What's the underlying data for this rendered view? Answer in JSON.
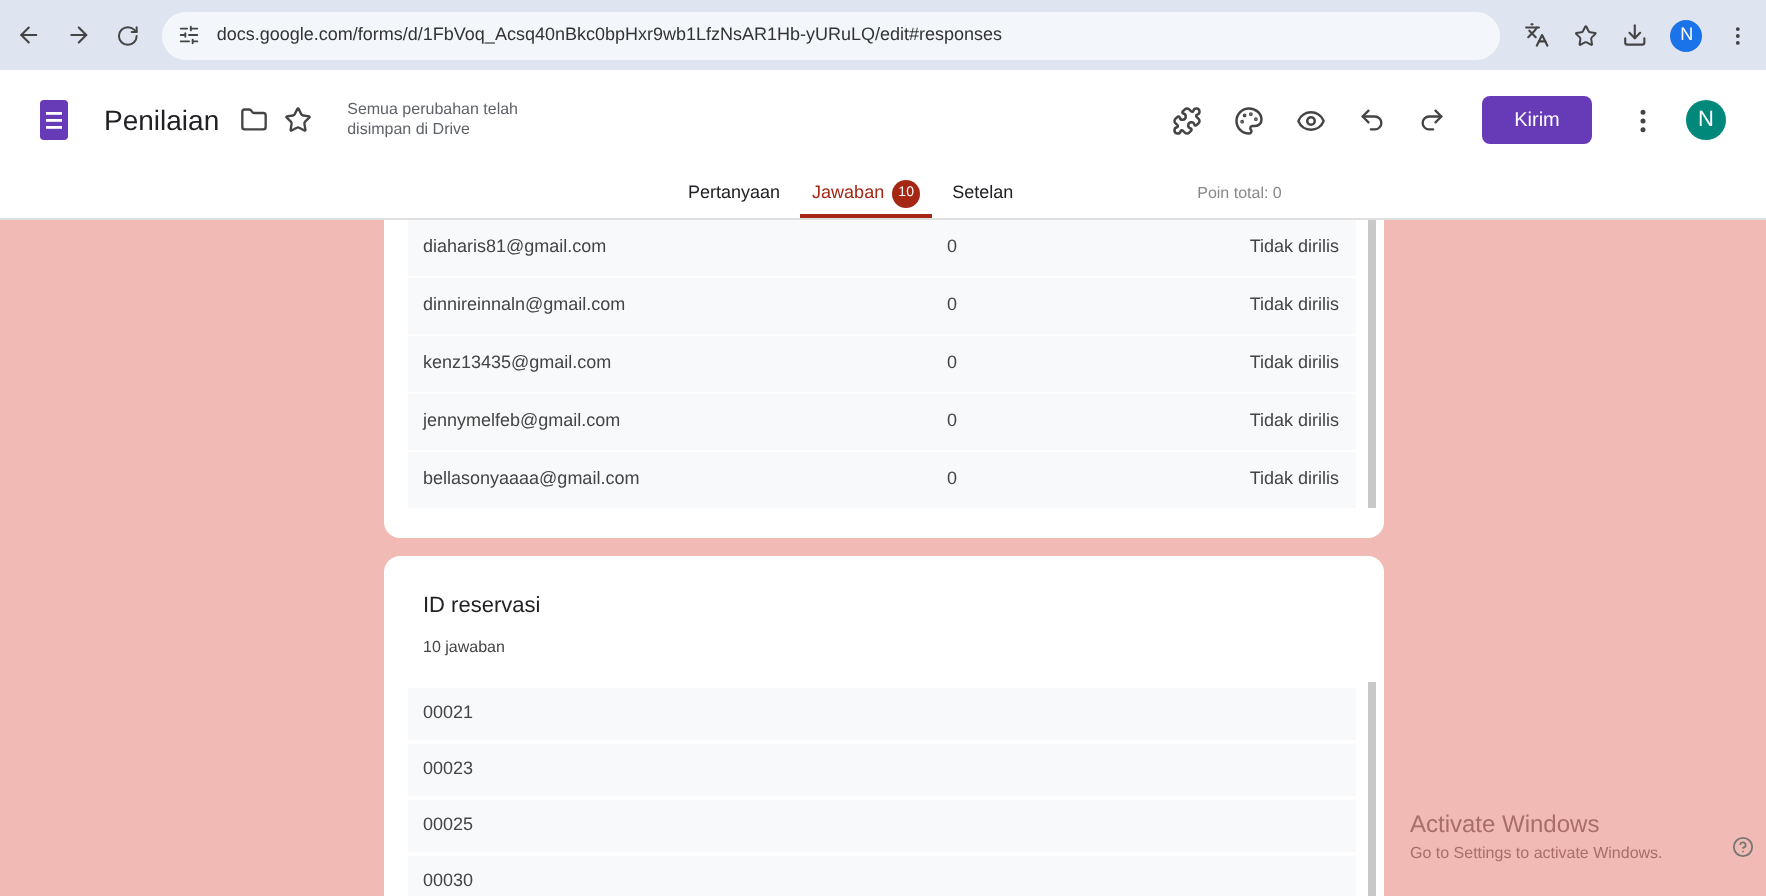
{
  "browser": {
    "url": "docs.google.com/forms/d/1FbVoq_Acsq40nBkc0bpHxr9wb1LfzNsAR1Hb-yURuLQ/edit#responses",
    "profile_initial": "N"
  },
  "app": {
    "title": "Penilaian",
    "save_status": "Semua perubahan telah disimpan di Drive",
    "send_button": "Kirim",
    "avatar_initial": "N"
  },
  "tabs": [
    {
      "label": "Pertanyaan",
      "selected": false
    },
    {
      "label": "Jawaban",
      "selected": true,
      "badge": "10"
    },
    {
      "label": "Setelan",
      "selected": false
    }
  ],
  "points_total": "Poin total: 0",
  "score_rows": [
    {
      "email": "diaharis81@gmail.com",
      "score": "0",
      "status": "Tidak dirilis"
    },
    {
      "email": "dinnireinnaln@gmail.com",
      "score": "0",
      "status": "Tidak dirilis"
    },
    {
      "email": "kenz13435@gmail.com",
      "score": "0",
      "status": "Tidak dirilis"
    },
    {
      "email": "jennymelfeb@gmail.com",
      "score": "0",
      "status": "Tidak dirilis"
    },
    {
      "email": "bellasonyaaaa@gmail.com",
      "score": "0",
      "status": "Tidak dirilis"
    }
  ],
  "question": {
    "title": "ID reservasi",
    "count": "10 jawaban",
    "answers": [
      "00021",
      "00023",
      "00025",
      "00030"
    ]
  },
  "activation": {
    "title": "Activate Windows",
    "subtitle": "Go to Settings to activate Windows."
  }
}
